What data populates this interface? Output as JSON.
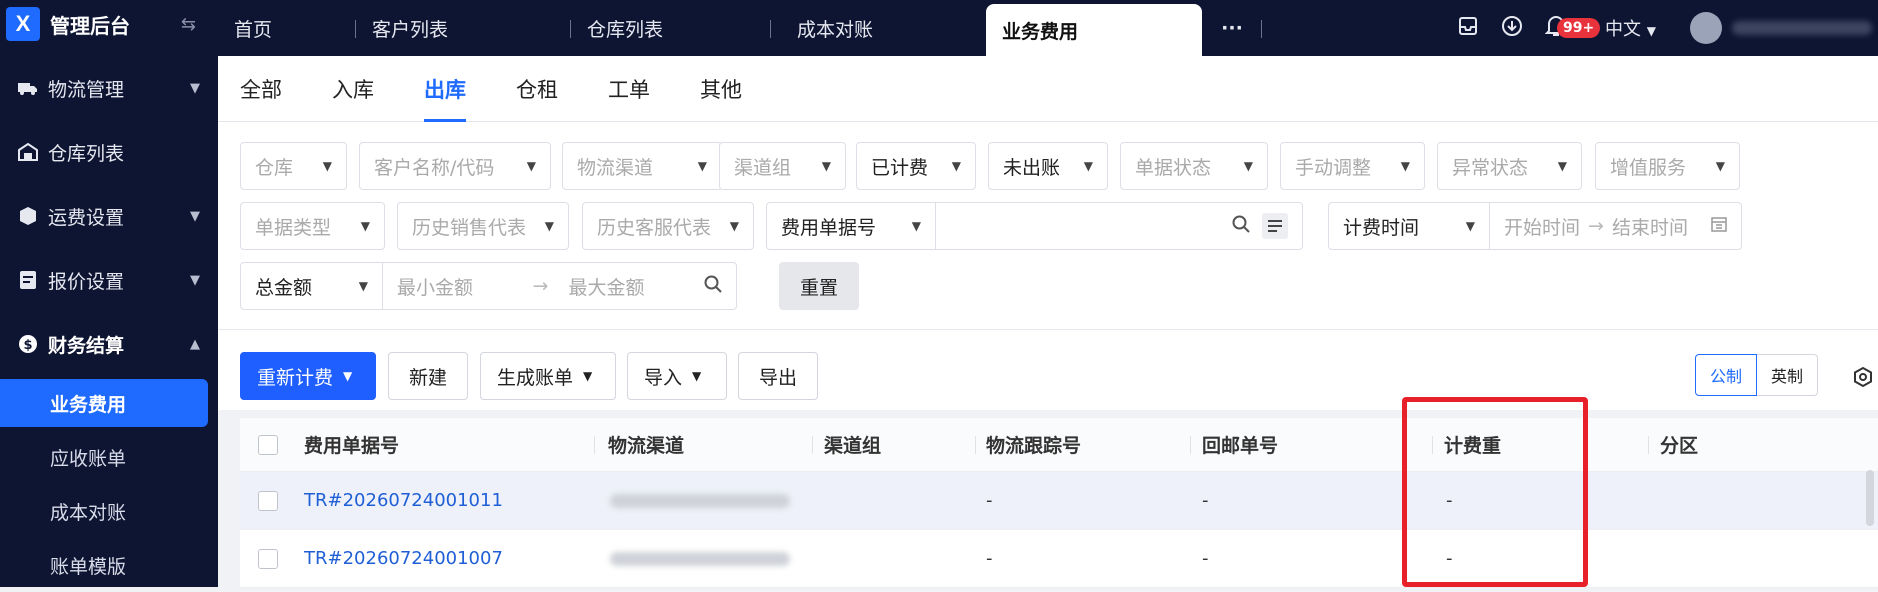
{
  "app": {
    "logo_letter": "X",
    "title": "管理后台"
  },
  "sidebar": {
    "items": [
      {
        "label": "物流管理",
        "icon": "truck-icon"
      },
      {
        "label": "仓库列表",
        "icon": "warehouse-icon"
      },
      {
        "label": "运费设置",
        "icon": "box-icon"
      },
      {
        "label": "报价设置",
        "icon": "document-icon"
      },
      {
        "label": "财务结算",
        "icon": "dollar-icon"
      }
    ],
    "sub_items": [
      "业务费用",
      "应收账单",
      "成本对账",
      "账单模版"
    ]
  },
  "top_tabs": [
    "首页",
    "客户列表",
    "仓库列表",
    "成本对账",
    "业务费用"
  ],
  "top_right": {
    "badge": "99+",
    "language": "中文"
  },
  "sub_tabs": [
    "全部",
    "入库",
    "出库",
    "仓租",
    "工单",
    "其他"
  ],
  "filters": {
    "row1": [
      "仓库",
      "客户名称/代码",
      "物流渠道",
      "渠道组",
      "已计费",
      "未出账",
      "单据状态",
      "手动调整",
      "异常状态",
      "增值服务"
    ],
    "row2": {
      "doc_type": "单据类型",
      "sales_rep": "历史销售代表",
      "cs_rep": "历史客服代表",
      "fee_doc_no": "费用单据号",
      "fee_time": "计费时间",
      "start": "开始时间",
      "end": "结束时间"
    },
    "row3": {
      "amount": "总金额",
      "min": "最小金额",
      "max": "最大金额",
      "reset": "重置"
    }
  },
  "toolbar": {
    "recalc": "重新计费",
    "create": "新建",
    "gen_bill": "生成账单",
    "import": "导入",
    "export": "导出",
    "metric": "公制",
    "imperial": "英制"
  },
  "table": {
    "headers": [
      "费用单据号",
      "物流渠道",
      "渠道组",
      "物流跟踪号",
      "回邮单号",
      "计费重",
      "分区"
    ],
    "rows": [
      {
        "doc_no": "TR#20260724001011",
        "tracking": "-",
        "return_no": "-",
        "weight": "-"
      },
      {
        "doc_no": "TR#20260724001007",
        "tracking": "-",
        "return_no": "-",
        "weight": "-"
      }
    ]
  },
  "colors": {
    "sidebar": "#0e1533",
    "accent": "#1f6bff",
    "highlight": "#e8202a"
  }
}
